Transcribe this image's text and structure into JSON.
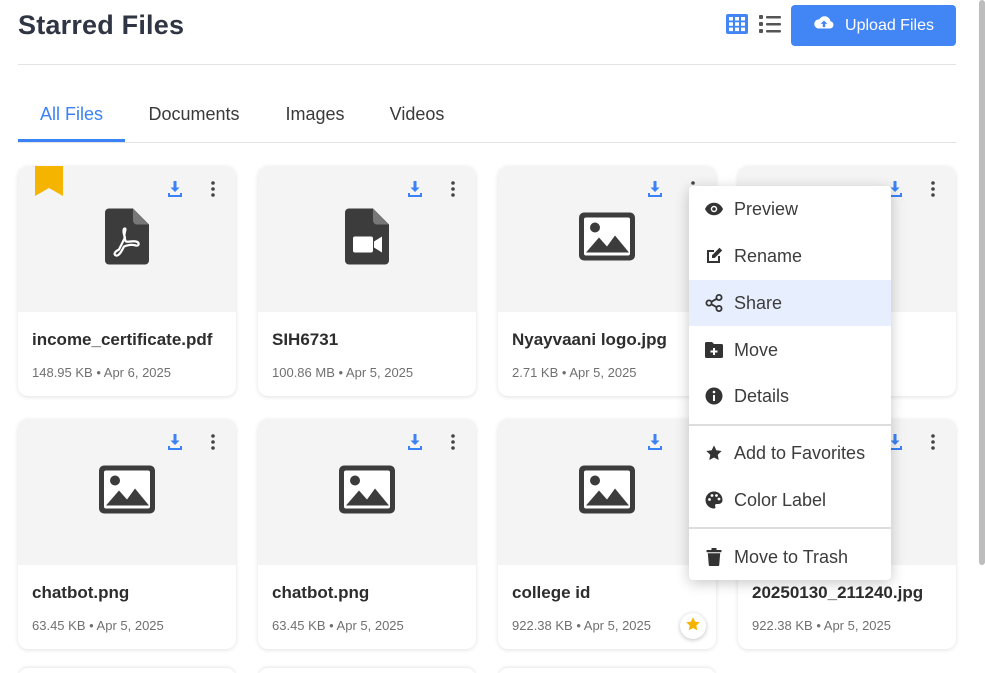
{
  "header": {
    "title": "Starred Files",
    "upload_label": "Upload Files"
  },
  "tabs": [
    {
      "label": "All Files",
      "active": true
    },
    {
      "label": "Documents",
      "active": false
    },
    {
      "label": "Images",
      "active": false
    },
    {
      "label": "Videos",
      "active": false
    }
  ],
  "files": [
    {
      "name": "income_certificate.pdf",
      "meta": "148.95 KB • Apr 6, 2025",
      "icon": "pdf-file-icon",
      "bookmarked": true
    },
    {
      "name": "SIH6731",
      "meta": "100.86 MB • Apr 5, 2025",
      "icon": "video-file-icon"
    },
    {
      "name": "Nyayvaani logo.jpg",
      "meta": "2.71 KB • Apr 5, 2025",
      "icon": "image-icon"
    },
    {
      "name": "",
      "meta": "",
      "icon": "image-icon"
    },
    {
      "name": "chatbot.png",
      "meta": "63.45 KB • Apr 5, 2025",
      "icon": "image-icon"
    },
    {
      "name": "chatbot.png",
      "meta": "63.45 KB • Apr 5, 2025",
      "icon": "image-icon"
    },
    {
      "name": "college id",
      "meta": "922.38 KB • Apr 5, 2025",
      "icon": "image-icon",
      "starred_badge": true
    },
    {
      "name": "20250130_211240.jpg",
      "meta": "922.38 KB • Apr 5, 2025",
      "icon": "image-icon"
    }
  ],
  "context_menu": {
    "items": [
      {
        "label": "Preview",
        "icon": "eye-icon"
      },
      {
        "label": "Rename",
        "icon": "edit-icon"
      },
      {
        "label": "Share",
        "icon": "share-icon",
        "highlighted": true
      },
      {
        "label": "Move",
        "icon": "folder-plus-icon"
      },
      {
        "label": "Details",
        "icon": "info-icon"
      },
      {
        "label": "Add to Favorites",
        "icon": "star-icon"
      },
      {
        "label": "Color Label",
        "icon": "palette-icon"
      },
      {
        "label": "Move to Trash",
        "icon": "trash-icon"
      }
    ]
  },
  "colors": {
    "accent": "#4285f4",
    "tab_active": "#3b82f6",
    "bookmark": "#f5b400",
    "star": "#f5b400",
    "menu_highlight": "#e7efff"
  }
}
